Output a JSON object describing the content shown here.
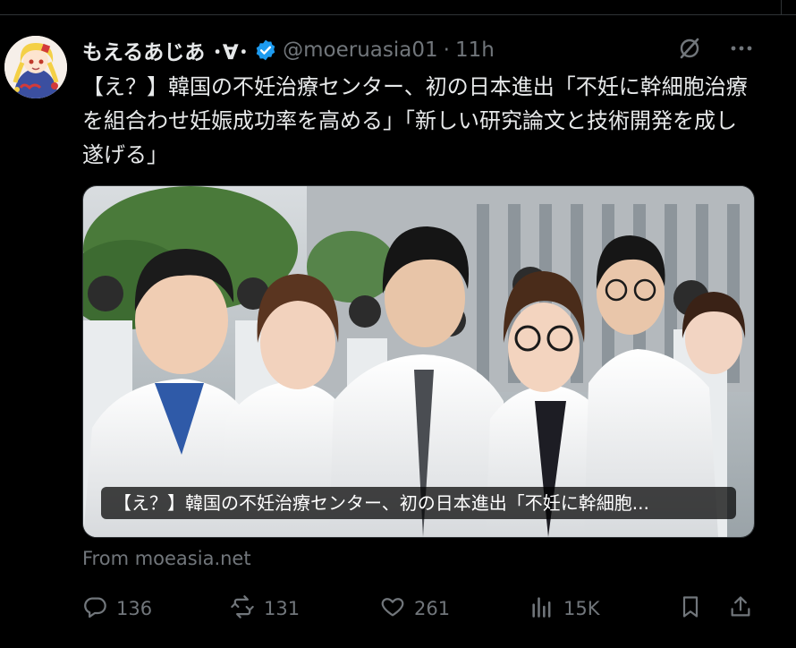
{
  "tweet": {
    "author": {
      "display_name": "もえるあじあ ･∀･",
      "handle": "@moeruasia01",
      "separator": "·",
      "time": "11h",
      "verified_icon": "verified-badge-icon",
      "accent_color": "#1d9bf0"
    },
    "text": "【え？】韓国の不妊治療センター、初の日本進出「不妊に幹細胞治療を組合わせ妊娠成功率を高める」「新しい研究論文と技術開発を成し遂げる」",
    "media": {
      "caption": "【え？】韓国の不妊治療センター、初の日本進出「不妊に幹細胞..."
    },
    "source_label": "From moeasia.net",
    "actions": {
      "reply_count": "136",
      "retweet_count": "131",
      "like_count": "261",
      "view_count": "15K"
    },
    "icons": [
      "grok-icon",
      "more-icon",
      "reply-icon",
      "retweet-icon",
      "like-icon",
      "views-icon",
      "bookmark-icon",
      "share-icon"
    ]
  }
}
